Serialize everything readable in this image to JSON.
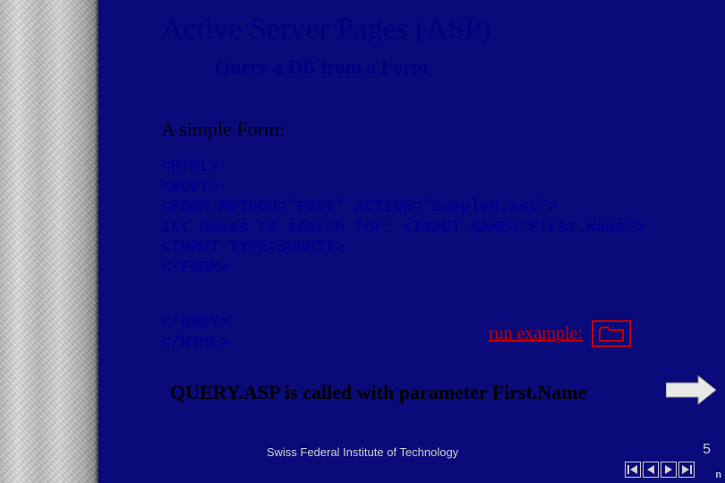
{
  "title": "Active Server Pages (ASP)",
  "subtitle": "Query a DB from a Form",
  "section_heading": "A simple Form:",
  "code_main": "<HTML>\n<BODY>\n<FORM METHOD=\"POST\" ACTION=\"Sample5.asp\">\n1st Names to search for: <INPUT NAME=\"First.Name\">\n<INPUT TYPE=SUBMIT>\n</FORM>",
  "code_closing": "</BODY>\n</HTML>",
  "run_example_label": "run example:",
  "result_text": "QUERY.ASP is called with parameter First.Name",
  "footer_institution": "Swiss Federal Institute of Technology",
  "slide_number": "5",
  "corner_mark": "n",
  "colors": {
    "background": "#0a0a7a",
    "title": "#000080",
    "code": "#000090",
    "accent_red": "#c00000",
    "footer_text": "#d0d0d0"
  }
}
